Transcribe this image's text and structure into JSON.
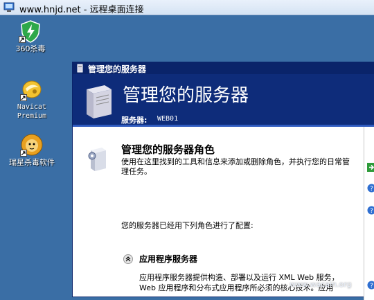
{
  "rdp_window": {
    "title": "www.hnjd.net - 远程桌面连接"
  },
  "desktop": {
    "icons": [
      {
        "label": "360杀毒",
        "icon": "shield-icon"
      },
      {
        "label": "Navicat\nPremium",
        "icon": "navicat-icon"
      },
      {
        "label": "瑞星杀毒软件",
        "icon": "lion-icon"
      }
    ]
  },
  "server_window": {
    "title": "管理您的服务器",
    "banner_heading": "管理您的服务器",
    "server_label": "服务器:",
    "server_name": "WEB01",
    "roles_title": "管理您的服务器角色",
    "roles_description": "使用在这里找到的工具和信息来添加或删除角色，并执行您的日常管理任务。",
    "configured_text": "您的服务器已经用下列角色进行了配置:",
    "app_server_title": "应用程序服务器",
    "app_server_description": "应用程序服务器提供构造、部署以及运行 XML Web 服务，Web 应用程序和分布式应用程序所必须的核心技术。应用"
  },
  "watermark": "www.wacain.org",
  "colors": {
    "desktop": "#3a6ea5",
    "banner": "#0e2c7a",
    "titlebar": "#0a246a"
  }
}
